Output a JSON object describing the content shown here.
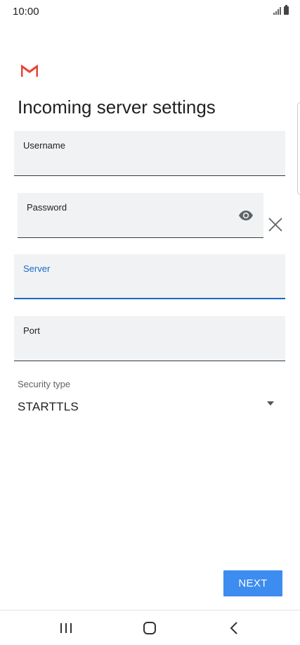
{
  "status_bar": {
    "time": "10:00"
  },
  "page": {
    "title": "Incoming server settings"
  },
  "form": {
    "username": {
      "label": "Username",
      "value": ""
    },
    "password": {
      "label": "Password",
      "value": ""
    },
    "server": {
      "label": "Server",
      "value": ""
    },
    "port": {
      "label": "Port",
      "value": ""
    },
    "security_type": {
      "label": "Security type",
      "value": "STARTTLS"
    }
  },
  "actions": {
    "next_label": "NEXT"
  },
  "icons": {
    "logo": "gmail-logo",
    "show_password": "eye-icon",
    "clear": "close-icon",
    "dropdown": "chevron-down-icon",
    "nav_recents": "recents-icon",
    "nav_home": "home-icon",
    "nav_back": "back-icon"
  },
  "colors": {
    "accent": "#1a68c9",
    "button": "#3d8cf0",
    "field_bg": "#f1f2f4",
    "gmail_red": "#ea4335"
  }
}
